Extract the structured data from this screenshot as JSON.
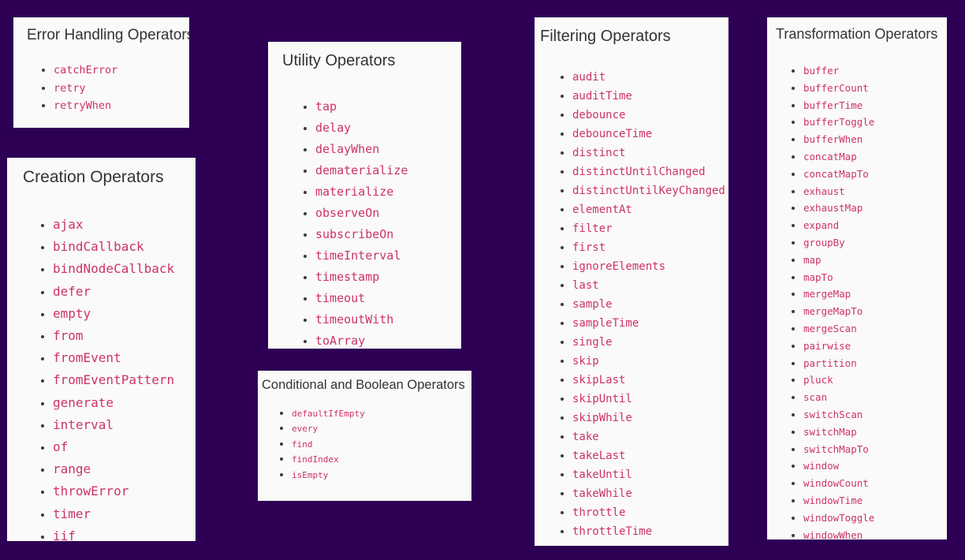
{
  "page": {
    "background_color": "#2e0055",
    "card_background_color": "#fafaf9",
    "title_color": "#333333",
    "operator_link_color": "#cc3366"
  },
  "cards": [
    {
      "id": "error-handling",
      "title": "Error Handling Operators",
      "operators": [
        "catchError",
        "retry",
        "retryWhen"
      ]
    },
    {
      "id": "creation",
      "title": "Creation Operators",
      "operators": [
        "ajax",
        "bindCallback",
        "bindNodeCallback",
        "defer",
        "empty",
        "from",
        "fromEvent",
        "fromEventPattern",
        "generate",
        "interval",
        "of",
        "range",
        "throwError",
        "timer",
        "iif"
      ]
    },
    {
      "id": "utility",
      "title": "Utility Operators",
      "operators": [
        "tap",
        "delay",
        "delayWhen",
        "dematerialize",
        "materialize",
        "observeOn",
        "subscribeOn",
        "timeInterval",
        "timestamp",
        "timeout",
        "timeoutWith",
        "toArray"
      ]
    },
    {
      "id": "conditional-boolean",
      "title": "Conditional and Boolean Operators",
      "operators": [
        "defaultIfEmpty",
        "every",
        "find",
        "findIndex",
        "isEmpty"
      ]
    },
    {
      "id": "filtering",
      "title": "Filtering Operators",
      "operators": [
        "audit",
        "auditTime",
        "debounce",
        "debounceTime",
        "distinct",
        "distinctUntilChanged",
        "distinctUntilKeyChanged",
        "elementAt",
        "filter",
        "first",
        "ignoreElements",
        "last",
        "sample",
        "sampleTime",
        "single",
        "skip",
        "skipLast",
        "skipUntil",
        "skipWhile",
        "take",
        "takeLast",
        "takeUntil",
        "takeWhile",
        "throttle",
        "throttleTime"
      ]
    },
    {
      "id": "transformation",
      "title": "Transformation Operators",
      "operators": [
        "buffer",
        "bufferCount",
        "bufferTime",
        "bufferToggle",
        "bufferWhen",
        "concatMap",
        "concatMapTo",
        "exhaust",
        "exhaustMap",
        "expand",
        "groupBy",
        "map",
        "mapTo",
        "mergeMap",
        "mergeMapTo",
        "mergeScan",
        "pairwise",
        "partition",
        "pluck",
        "scan",
        "switchScan",
        "switchMap",
        "switchMapTo",
        "window",
        "windowCount",
        "windowTime",
        "windowToggle",
        "windowWhen"
      ]
    }
  ]
}
